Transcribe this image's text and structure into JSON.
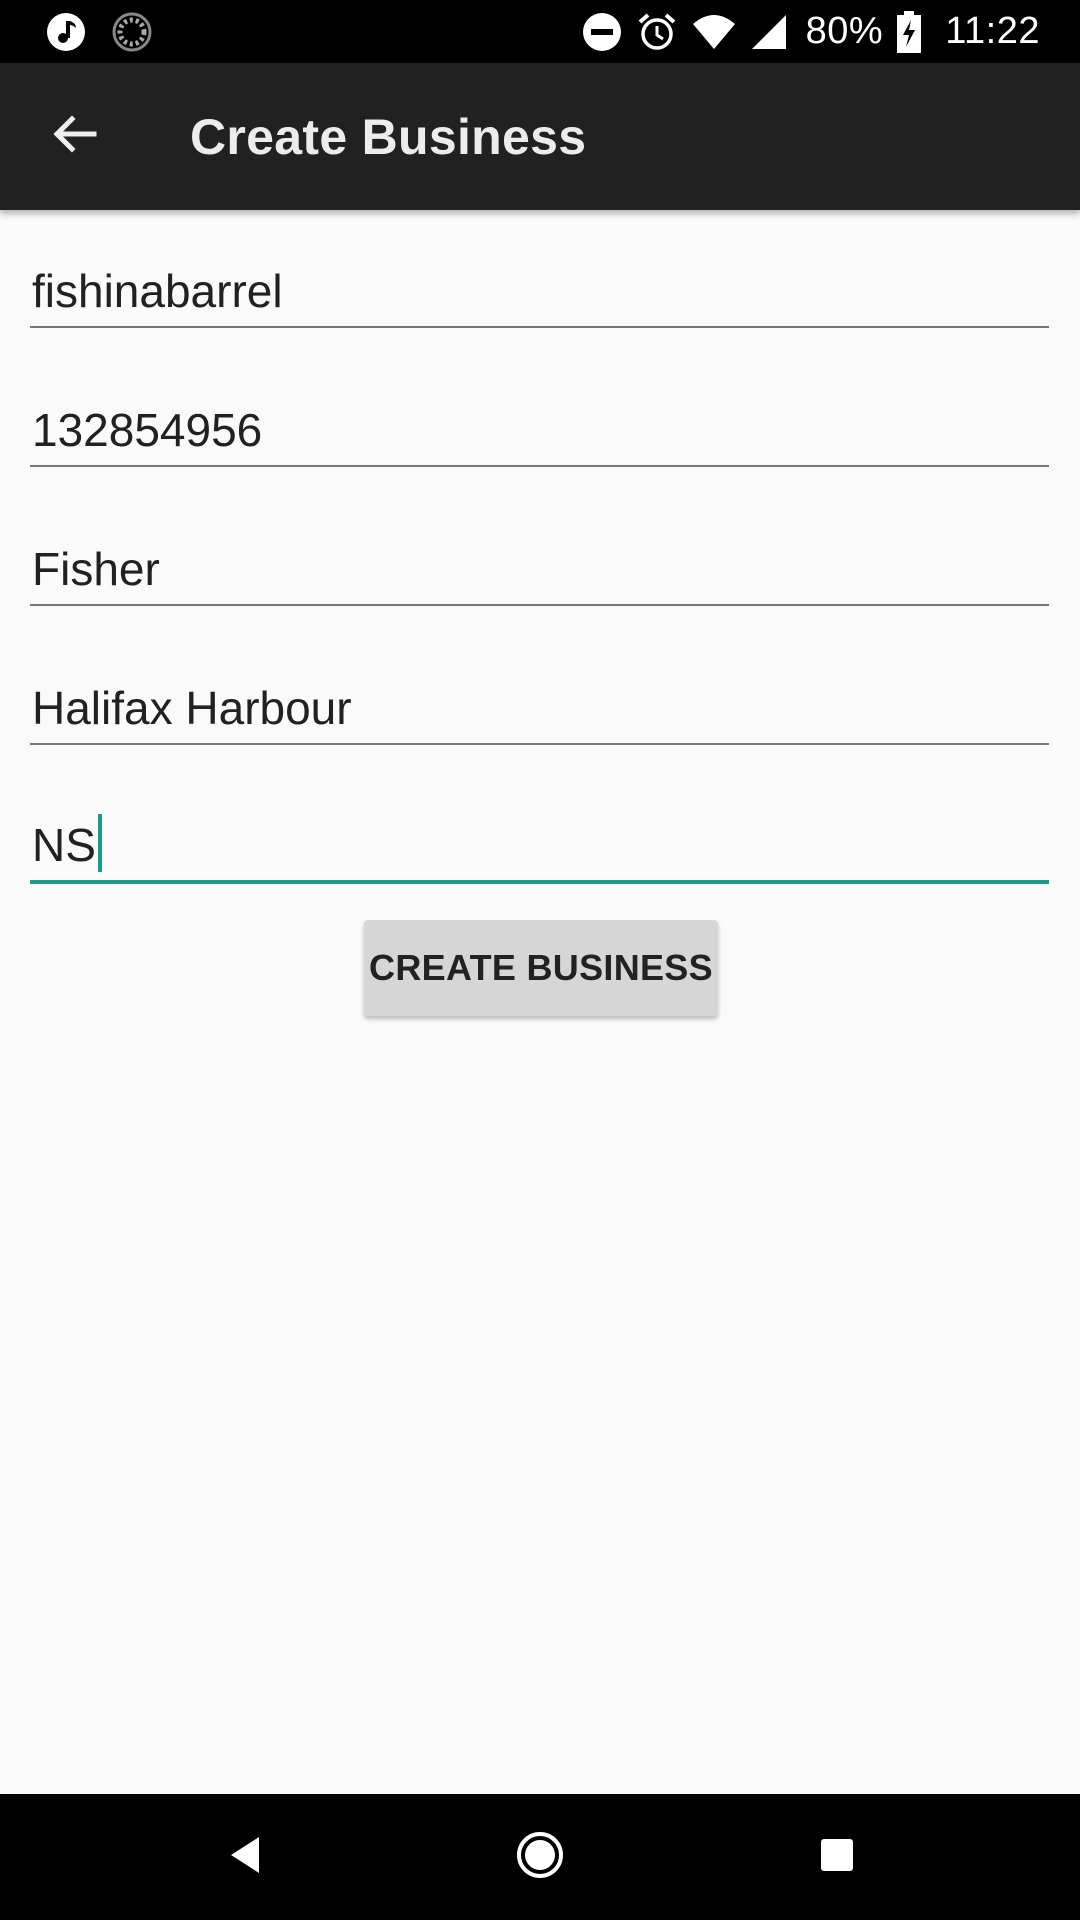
{
  "status_bar": {
    "battery_percent": "80%",
    "time": "11:22",
    "icons": [
      "music-notification-icon",
      "loading-notification-icon",
      "do-not-disturb-icon",
      "alarm-icon",
      "wifi-icon",
      "cell-signal-icon",
      "battery-charging-icon"
    ]
  },
  "app_bar": {
    "title": "Create Business",
    "back_icon": "arrow-back-icon"
  },
  "form": {
    "fields": [
      {
        "value": "fishinabarrel"
      },
      {
        "value": "132854956"
      },
      {
        "value": "Fisher"
      },
      {
        "value": "Halifax Harbour"
      },
      {
        "value": "NS",
        "focused": true
      }
    ],
    "submit_label": "CREATE BUSINESS"
  },
  "colors": {
    "accent": "#1a9b8c",
    "app_bar": "#212121",
    "background": "#fafafa",
    "button": "#d6d6d6"
  },
  "nav_bar": {
    "icons": [
      "nav-back-icon",
      "nav-home-icon",
      "nav-recents-icon"
    ]
  }
}
